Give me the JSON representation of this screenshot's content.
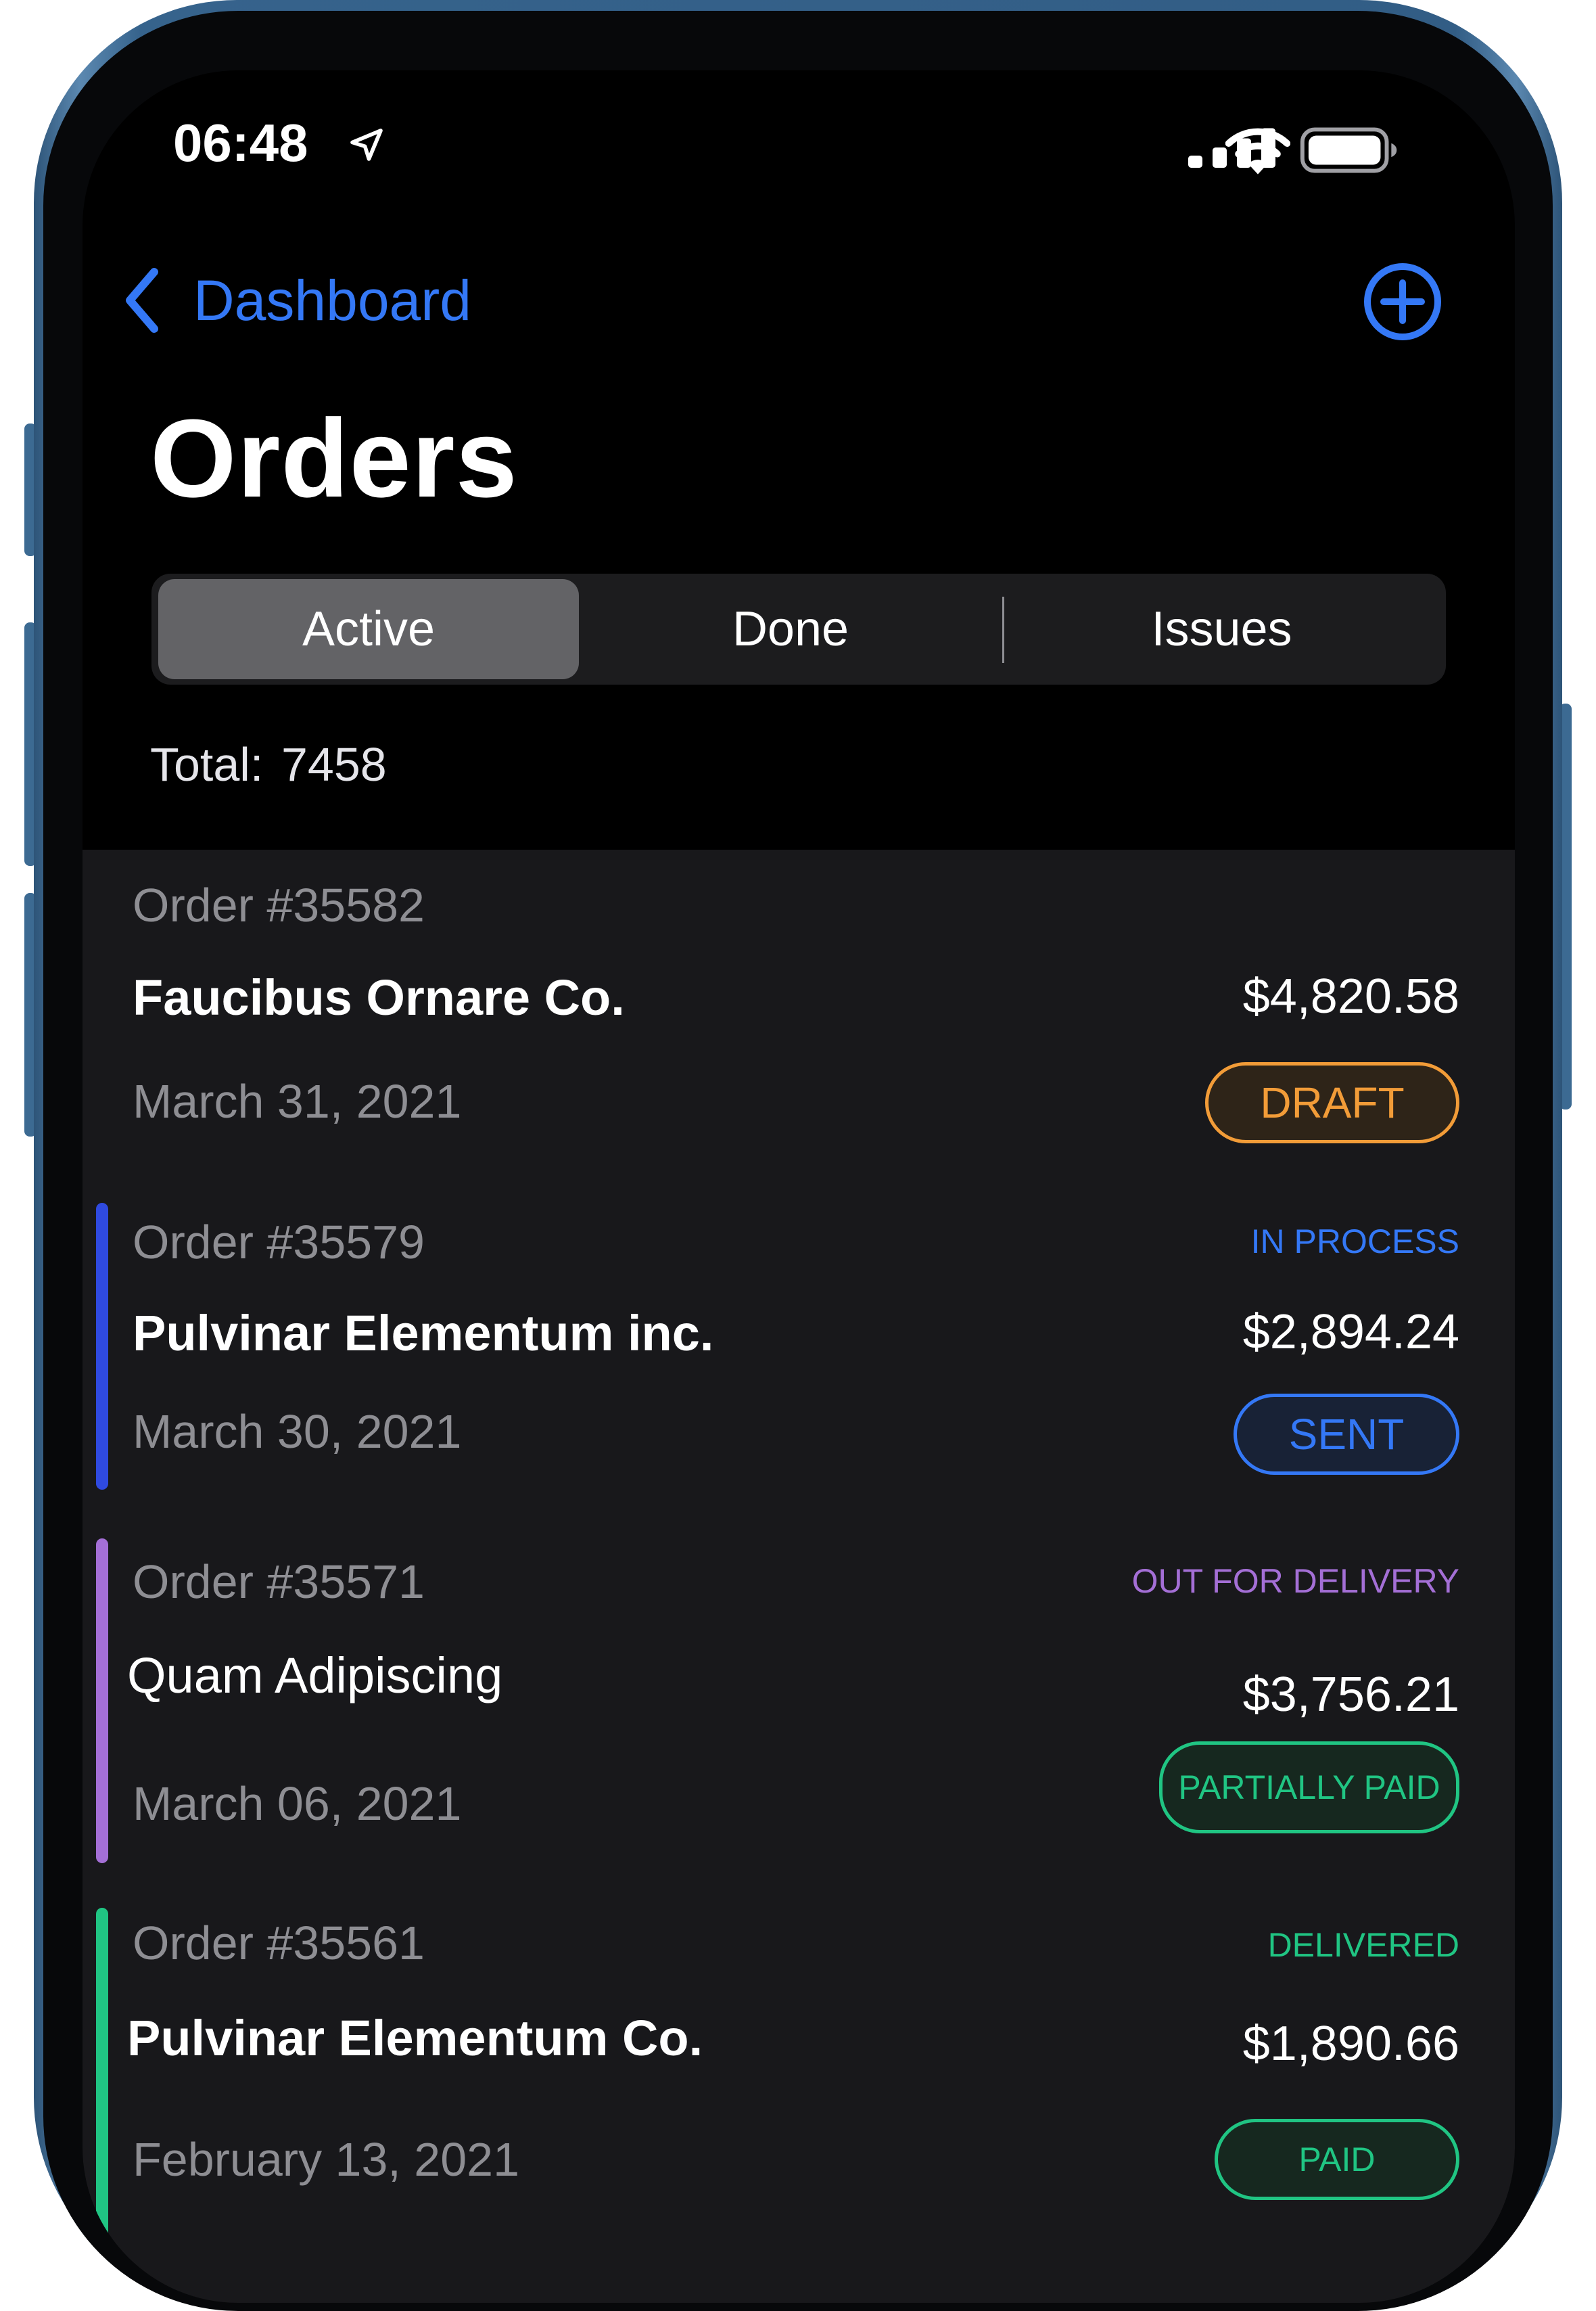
{
  "status_bar": {
    "time": "06:48"
  },
  "nav": {
    "back_label": "Dashboard",
    "title": "Orders"
  },
  "segments": [
    "Active",
    "Done",
    "Issues"
  ],
  "summary": {
    "total_label": "Total:",
    "total_value": "7458"
  },
  "orders": [
    {
      "number": "Order #35582",
      "company": "Faucibus Ornare Co.",
      "amount": "$4,820.58",
      "date": "March 31, 2021",
      "status": "",
      "badge": "DRAFT"
    },
    {
      "number": "Order #35579",
      "company": "Pulvinar Elementum inc.",
      "amount": "$2,894.24",
      "date": "March 30, 2021",
      "status": "IN PROCESS",
      "badge": "SENT"
    },
    {
      "number": "Order #35571",
      "company": "Quam Adipiscing",
      "amount": "$3,756.21",
      "date": "March 06, 2021",
      "status": "OUT FOR DELIVERY",
      "badge": "PARTIALLY PAID"
    },
    {
      "number": "Order #35561",
      "company": "Pulvinar Elementum Co.",
      "amount": "$1,890.66",
      "date": "February 13, 2021",
      "status": "DELIVERED",
      "badge": "PAID"
    }
  ],
  "colors": {
    "accent": "#3478f6",
    "draft": "#f29c38",
    "in_process": "#2f5de0",
    "sent": "#3478f6",
    "out_for_delivery": "#a46fd6",
    "paid": "#20c583"
  }
}
